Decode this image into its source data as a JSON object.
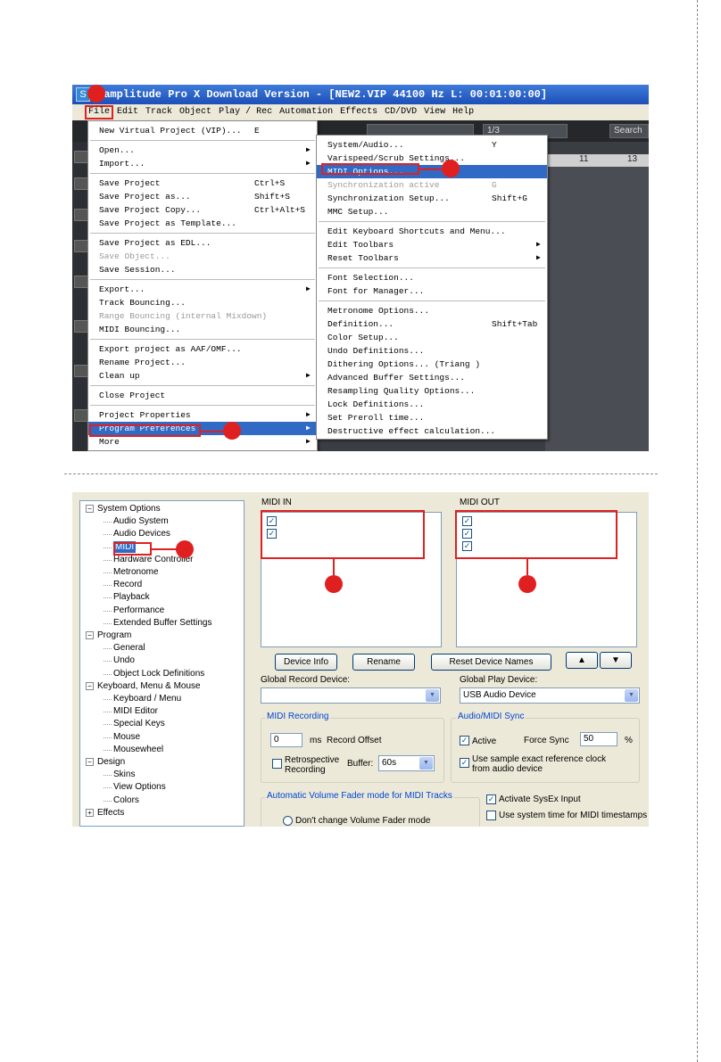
{
  "shot1": {
    "title": "Samplitude Pro X Download Version - [NEW2.VIP   44100 Hz L: 00:01:00:00]",
    "menubar": [
      "File",
      "Edit",
      "Track",
      "Object",
      "Play / Rec",
      "Automation",
      "Effects",
      "CD/DVD",
      "View",
      "Help"
    ],
    "toolbar": {
      "search_label": "Search",
      "zoom_value": "1/3"
    },
    "ruler": [
      "11",
      "13"
    ],
    "file_menu": [
      {
        "label": "New Virtual Project (VIP)...",
        "shortcut": "E"
      },
      {
        "sep": true
      },
      {
        "label": "Open...",
        "submenu": true
      },
      {
        "label": "Import...",
        "submenu": true
      },
      {
        "sep": true
      },
      {
        "label": "Save Project",
        "shortcut": "Ctrl+S"
      },
      {
        "label": "Save Project as...",
        "shortcut": "Shift+S"
      },
      {
        "label": "Save Project Copy...",
        "shortcut": "Ctrl+Alt+S"
      },
      {
        "label": "Save Project as Template..."
      },
      {
        "sep": true
      },
      {
        "label": "Save Project as EDL..."
      },
      {
        "label": "Save Object...",
        "disabled": true
      },
      {
        "label": "Save Session..."
      },
      {
        "sep": true
      },
      {
        "label": "Export...",
        "submenu": true
      },
      {
        "label": "Track Bouncing..."
      },
      {
        "label": "Range Bouncing (internal Mixdown)",
        "disabled": true
      },
      {
        "label": "MIDI Bouncing..."
      },
      {
        "sep": true
      },
      {
        "label": "Export project as AAF/OMF..."
      },
      {
        "label": "Rename Project..."
      },
      {
        "label": "Clean up",
        "submenu": true
      },
      {
        "sep": true
      },
      {
        "label": "Close Project"
      },
      {
        "sep": true
      },
      {
        "label": "Project Properties",
        "submenu": true
      },
      {
        "label": "Program Preferences",
        "submenu": true,
        "highlight": true
      },
      {
        "label": "More",
        "submenu": true
      }
    ],
    "prefs_menu": [
      {
        "label": "System/Audio...",
        "shortcut": "Y"
      },
      {
        "label": "Varispeed/Scrub Settings..."
      },
      {
        "label": "MIDI Options...",
        "highlight": true
      },
      {
        "label": "Synchronization active",
        "shortcut": "G",
        "disabled": true
      },
      {
        "label": "Synchronization Setup...",
        "shortcut": "Shift+G"
      },
      {
        "label": "MMC Setup..."
      },
      {
        "sep": true
      },
      {
        "label": "Edit Keyboard Shortcuts and Menu..."
      },
      {
        "label": "Edit Toolbars",
        "submenu": true
      },
      {
        "label": "Reset Toolbars",
        "submenu": true
      },
      {
        "sep": true
      },
      {
        "label": "Font Selection..."
      },
      {
        "label": "Font for Manager..."
      },
      {
        "sep": true
      },
      {
        "label": "Metronome Options..."
      },
      {
        "label": "Definition...",
        "shortcut": "Shift+Tab"
      },
      {
        "label": "Color Setup..."
      },
      {
        "label": "Undo Definitions..."
      },
      {
        "label": "Dithering Options... (Triang )"
      },
      {
        "label": "Advanced Buffer Settings..."
      },
      {
        "label": "Resampling Quality Options..."
      },
      {
        "label": "Lock Definitions..."
      },
      {
        "label": "Set Preroll time..."
      },
      {
        "label": "Destructive effect calculation..."
      }
    ]
  },
  "shot2": {
    "tree": [
      {
        "label": "System Options",
        "level": 0,
        "expander": "minus"
      },
      {
        "label": "Audio System",
        "level": 1
      },
      {
        "label": "Audio Devices",
        "level": 1
      },
      {
        "label": "MIDI",
        "level": 1,
        "selected": true
      },
      {
        "label": "Hardware Controller",
        "level": 1
      },
      {
        "label": "Metronome",
        "level": 1
      },
      {
        "label": "Record",
        "level": 1
      },
      {
        "label": "Playback",
        "level": 1
      },
      {
        "label": "Performance",
        "level": 1
      },
      {
        "label": "Extended Buffer Settings",
        "level": 1
      },
      {
        "label": "Program",
        "level": 0,
        "expander": "minus"
      },
      {
        "label": "General",
        "level": 1
      },
      {
        "label": "Undo",
        "level": 1
      },
      {
        "label": "Object Lock Definitions",
        "level": 1
      },
      {
        "label": "Keyboard, Menu & Mouse",
        "level": 0,
        "expander": "minus"
      },
      {
        "label": "Keyboard / Menu",
        "level": 1
      },
      {
        "label": "MIDI Editor",
        "level": 1
      },
      {
        "label": "Special Keys",
        "level": 1
      },
      {
        "label": "Mouse",
        "level": 1
      },
      {
        "label": "Mousewheel",
        "level": 1
      },
      {
        "label": "Design",
        "level": 0,
        "expander": "minus"
      },
      {
        "label": "Skins",
        "level": 1
      },
      {
        "label": "View Options",
        "level": 1
      },
      {
        "label": "Colors",
        "level": 1
      },
      {
        "label": "Effects",
        "level": 0,
        "expander": "plus"
      }
    ],
    "midi_in": {
      "title": "MIDI IN",
      "checked_count": 2
    },
    "midi_out": {
      "title": "MIDI OUT",
      "checked_count": 3
    },
    "buttons": {
      "device_info": "Device Info",
      "rename": "Rename",
      "reset_names": "Reset Device Names"
    },
    "global_record": {
      "label": "Global Record Device:",
      "value": ""
    },
    "global_play": {
      "label": "Global Play Device:",
      "value": "USB Audio Device"
    },
    "midi_recording": {
      "title": "MIDI Recording",
      "offset_value": "0",
      "offset_unit": "ms",
      "offset_label": "Record Offset",
      "retro_label": "Retrospective Recording",
      "buffer_label": "Buffer:",
      "buffer_value": "60s"
    },
    "sync": {
      "title": "Audio/MIDI Sync",
      "active_label": "Active",
      "force_sync_label": "Force Sync",
      "force_sync_value": "50",
      "force_sync_unit": "%",
      "sample_exact_label": "Use sample exact reference clock from audio device"
    },
    "fader_mode": {
      "title": "Automatic Volume Fader mode for MIDI Tracks",
      "option1": "Don't change Volume Fader mode"
    },
    "sysex_label": "Activate SysEx Input",
    "timestamps_label": "Use system time for MIDI timestamps"
  },
  "accent_red": "#e02020",
  "highlight_blue": "#316ac5"
}
